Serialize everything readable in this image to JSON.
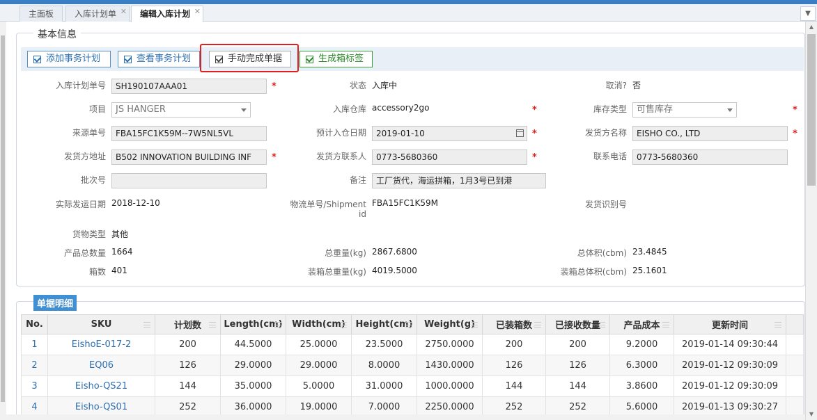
{
  "tabs": [
    {
      "label": "主面板",
      "closable": false
    },
    {
      "label": "入库计划单",
      "closable": true
    },
    {
      "label": "编辑入库计划",
      "closable": true,
      "active": true
    }
  ],
  "section_basic": "基本信息",
  "section_detail": "单据明细",
  "buttons": {
    "add_plan": "添加事务计划",
    "view_plan": "查看事务计划",
    "manual_complete": "手动完成单据",
    "gen_label": "生成箱标签"
  },
  "form": {
    "plan_no_label": "入库计划单号",
    "plan_no": "SH190107AAA01",
    "status_label": "状态",
    "status": "入库中",
    "cancel_label": "取消?",
    "cancel": "否",
    "project_label": "项目",
    "project": "JS HANGER",
    "warehouse_label": "入库仓库",
    "warehouse": "accessory2go",
    "stock_type_label": "库存类型",
    "stock_type": "可售库存",
    "source_no_label": "来源单号",
    "source_no": "FBA15FC1K59M--7W5NL5VL",
    "expected_date_label": "预计入仓日期",
    "expected_date": "2019-01-10",
    "shipper_label": "发货方名称",
    "shipper": "EISHO CO., LTD",
    "shipper_addr_label": "发货方地址",
    "shipper_addr": "B502 INNOVATION  BUILDING INF",
    "shipper_contact_label": "发货方联系人",
    "shipper_contact": "0773-5680360",
    "phone_label": "联系电话",
    "phone": "0773-5680360",
    "batch_label": "批次号",
    "batch": "",
    "remark_label": "备注",
    "remark": "工厂货代，海运拼箱，1月3号已到港",
    "ship_date_label": "实际发运日期",
    "ship_date": "2018-12-10",
    "shipment_label_1": "物流单号/Shipment",
    "shipment_label_2": "id",
    "shipment": "FBA15FC1K59M",
    "ship_id_label": "发货识别号",
    "ship_id": "",
    "goods_type_label": "货物类型",
    "goods_type": "其他",
    "total_qty_label": "产品总数量",
    "total_qty": "1664",
    "total_weight_label": "总重量(kg)",
    "total_weight": "2867.6800",
    "total_volume_label": "总体积(cbm)",
    "total_volume": "23.4845",
    "boxes_label": "箱数",
    "boxes": "401",
    "box_weight_label": "装箱总重量(kg)",
    "box_weight": "4019.5000",
    "box_volume_label": "装箱总体积(cbm)",
    "box_volume": "25.1601"
  },
  "table": {
    "headers": [
      "No.",
      "SKU",
      "计划数",
      "Length(cm)",
      "Width(cm)",
      "Height(cm)",
      "Weight(g)",
      "已装箱数",
      "已接收数量",
      "产品成本",
      "更新时间"
    ],
    "rows": [
      [
        "1",
        "EishoE-017-2",
        "200",
        "44.5000",
        "25.0000",
        "23.5000",
        "2750.0000",
        "200",
        "200",
        "9.2000",
        "2019-01-14 09:30:44"
      ],
      [
        "2",
        "EQ06",
        "126",
        "29.0000",
        "29.0000",
        "8.0000",
        "1430.0000",
        "126",
        "126",
        "6.3000",
        "2019-01-12 09:30:09"
      ],
      [
        "3",
        "Eisho-QS21",
        "144",
        "35.0000",
        "5.0000",
        "31.0000",
        "1000.0000",
        "144",
        "144",
        "3.8600",
        "2019-01-12 09:30:09"
      ],
      [
        "4",
        "Eisho-QS01",
        "252",
        "36.0000",
        "19.0000",
        "7.0000",
        "2250.0000",
        "252",
        "252",
        "5.6000",
        "2019-01-13 09:30:27"
      ]
    ]
  }
}
